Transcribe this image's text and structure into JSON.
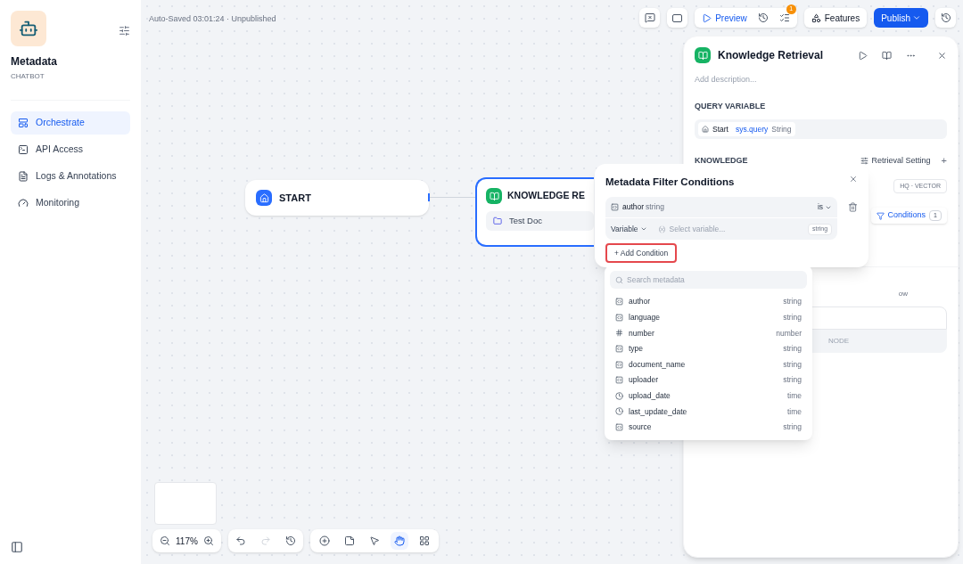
{
  "app": {
    "name": "Metadata",
    "type": "CHATBOT"
  },
  "nav": [
    {
      "label": "Orchestrate",
      "selected": true
    },
    {
      "label": "API Access",
      "selected": false
    },
    {
      "label": "Logs & Annotations",
      "selected": false
    },
    {
      "label": "Monitoring",
      "selected": false
    }
  ],
  "status": "Auto-Saved 03:01:24 · Unpublished",
  "toolbar": {
    "preview": "Preview",
    "badge": "1",
    "features": "Features",
    "publish": "Publish"
  },
  "canvas": {
    "start": "START",
    "knowledge": "KNOWLEDGE RE",
    "doc": "Test Doc",
    "zoom": "117%",
    "tools": [
      {
        "selected": false
      },
      {
        "selected": false
      },
      {
        "selected": false
      },
      {
        "selected": true
      },
      {
        "selected": false
      }
    ]
  },
  "panel": {
    "title": "Knowledge Retrieval",
    "description_placeholder": "Add description...",
    "query_label": "QUERY VARIABLE",
    "variable": {
      "node": "Start",
      "name": "sys.query",
      "type": "String"
    },
    "knowledge_label": "KNOWLEDGE",
    "retrieval_setting": "Retrieval Setting",
    "add_symbol": "+",
    "badge": "HQ · VECTOR",
    "conditions": "Conditions",
    "conditions_count": "1",
    "fragment_label": "ow",
    "fragment_node": "NODE"
  },
  "popover": {
    "title": "Metadata Filter Conditions",
    "condition": {
      "field": "author",
      "type": "string",
      "operator": "is",
      "value_mode": "Variable",
      "placeholder": "Select variable...",
      "value_type": "string"
    },
    "add": "+ Add Condition",
    "add_highlighted": true
  },
  "dropdown": {
    "placeholder": "Search metadata",
    "items": [
      {
        "name": "author",
        "type": "string",
        "kind": "string"
      },
      {
        "name": "language",
        "type": "string",
        "kind": "string"
      },
      {
        "name": "number",
        "type": "number",
        "kind": "number"
      },
      {
        "name": "type",
        "type": "string",
        "kind": "string"
      },
      {
        "name": "document_name",
        "type": "string",
        "kind": "string"
      },
      {
        "name": "uploader",
        "type": "string",
        "kind": "string"
      },
      {
        "name": "upload_date",
        "type": "time",
        "kind": "time"
      },
      {
        "name": "last_update_date",
        "type": "time",
        "kind": "time"
      },
      {
        "name": "source",
        "type": "string",
        "kind": "string"
      }
    ]
  }
}
